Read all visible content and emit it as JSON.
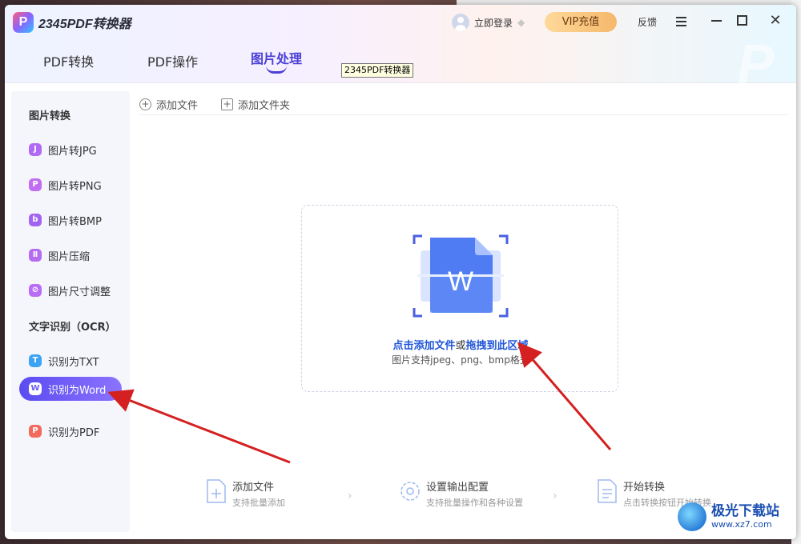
{
  "app": {
    "logo_letter": "P",
    "title": "2345PDF转换器",
    "login_label": "立即登录",
    "vip_label": "VIP充值",
    "feedback_label": "反馈",
    "tooltip": "2345PDF转换器"
  },
  "tabs": [
    {
      "label": "PDF转换"
    },
    {
      "label": "PDF操作"
    },
    {
      "label": "图片处理",
      "active": true
    }
  ],
  "sidebar": {
    "section1": "图片转换",
    "section2": "文字识别（OCR）",
    "items": [
      {
        "label": "图片转JPG",
        "icon": "jpg-icon",
        "glyph": "J",
        "color": "#b06af5"
      },
      {
        "label": "图片转PNG",
        "icon": "png-icon",
        "glyph": "P",
        "color": "#c26cf2"
      },
      {
        "label": "图片转BMP",
        "icon": "bmp-icon",
        "glyph": "b",
        "color": "#a264f0"
      },
      {
        "label": "图片压缩",
        "icon": "compress-icon",
        "glyph": "Ⅱ",
        "color": "#b56cf0"
      },
      {
        "label": "图片尺寸调整",
        "icon": "resize-icon",
        "glyph": "⊘",
        "color": "#b96cf5"
      },
      {
        "label": "识别为TXT",
        "icon": "txt-icon",
        "glyph": "T",
        "color": "#3aa3f5"
      },
      {
        "label": "识别为Word",
        "icon": "word-icon",
        "glyph": "W",
        "color": "#ffffff",
        "active": true
      },
      {
        "label": "识别为PDF",
        "icon": "pdf-icon",
        "glyph": "P",
        "color": "#f26a5e"
      }
    ]
  },
  "toolbar": {
    "add_file": "添加文件",
    "add_folder": "添加文件夹"
  },
  "dropzone": {
    "link1": "点击添加文件",
    "or": "或",
    "link2": "拖拽到此区域",
    "sub": "图片支持jpeg、png、bmp格式"
  },
  "steps": [
    {
      "title": "添加文件",
      "desc": "支持批量添加",
      "icon": "add-file-step-icon"
    },
    {
      "title": "设置输出配置",
      "desc": "支持批量操作和各种设置",
      "icon": "settings-step-icon"
    },
    {
      "title": "开始转换",
      "desc": "点击转换按钮开始转换",
      "icon": "convert-step-icon"
    }
  ],
  "watermark": {
    "name": "极光下载站",
    "url": "www.xz7.com"
  },
  "colors": {
    "accent": "#4a3fd6",
    "link": "#1f55d8",
    "annotation_arrow": "#d42020"
  }
}
